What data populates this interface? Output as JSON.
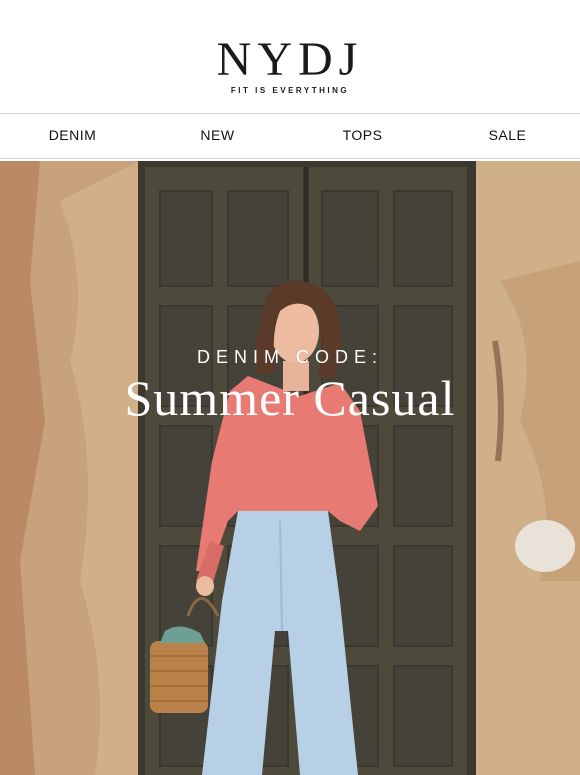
{
  "header": {
    "logo": "NYDJ",
    "tagline": "FIT IS EVERYTHING"
  },
  "nav": {
    "items": [
      "DENIM",
      "NEW",
      "TOPS",
      "SALE"
    ]
  },
  "hero": {
    "kicker": "DENIM CODE:",
    "headline": "Summer Casual",
    "photo_description_icon": "model-photo",
    "colors": {
      "wall": "#c9a985",
      "door": "#4a4538",
      "top": "#e77a73",
      "jeans": "#b7d0e6",
      "hair": "#5a3a28",
      "basket": "#b8824a"
    }
  }
}
